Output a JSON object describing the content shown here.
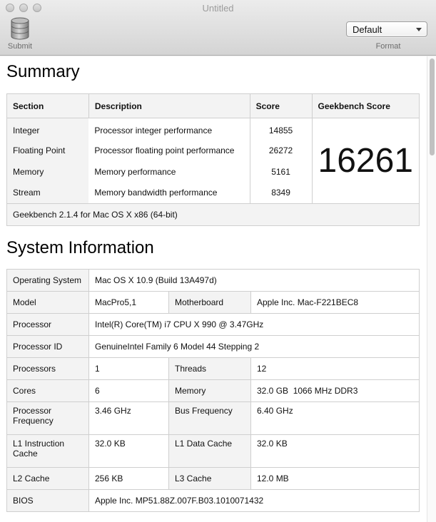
{
  "window": {
    "title": "Untitled"
  },
  "toolbar": {
    "submit_label": "Submit",
    "format_value": "Default",
    "format_label": "Format"
  },
  "summary": {
    "title": "Summary",
    "headers": {
      "section": "Section",
      "description": "Description",
      "score": "Score",
      "geekbench": "Geekbench Score"
    },
    "rows": [
      {
        "section": "Integer",
        "description": "Processor integer performance",
        "score": "14855"
      },
      {
        "section": "Floating Point",
        "description": "Processor floating point performance",
        "score": "26272"
      },
      {
        "section": "Memory",
        "description": "Memory performance",
        "score": "5161"
      },
      {
        "section": "Stream",
        "description": "Memory bandwidth performance",
        "score": "8349"
      }
    ],
    "geekbench_score": "16261",
    "footer": "Geekbench 2.1.4 for Mac OS X x86 (64-bit)"
  },
  "sysinfo": {
    "title": "System Information",
    "os_label": "Operating System",
    "os_value": "Mac OS X 10.9 (Build 13A497d)",
    "model_label": "Model",
    "model_value": "MacPro5,1",
    "mb_label": "Motherboard",
    "mb_value": "Apple Inc. Mac-F221BEC8",
    "proc_label": "Processor",
    "proc_value": "Intel(R) Core(TM) i7 CPU X 990 @ 3.47GHz",
    "procid_label": "Processor ID",
    "procid_value": "GenuineIntel Family 6 Model 44 Stepping 2",
    "procs_label": "Processors",
    "procs_value": "1",
    "threads_label": "Threads",
    "threads_value": "12",
    "cores_label": "Cores",
    "cores_value": "6",
    "mem_label": "Memory",
    "mem_value": "32.0 GB  1066 MHz DDR3",
    "freq_label": "Processor Frequency",
    "freq_value": "3.46 GHz",
    "bus_label": "Bus Frequency",
    "bus_value": "6.40 GHz",
    "l1i_label": "L1 Instruction Cache",
    "l1i_value": "32.0 KB",
    "l1d_label": "L1 Data Cache",
    "l1d_value": "32.0 KB",
    "l2_label": "L2 Cache",
    "l2_value": "256 KB",
    "l3_label": "L3 Cache",
    "l3_value": "12.0 MB",
    "bios_label": "BIOS",
    "bios_value": "Apple Inc. MP51.88Z.007F.B03.1010071432"
  }
}
